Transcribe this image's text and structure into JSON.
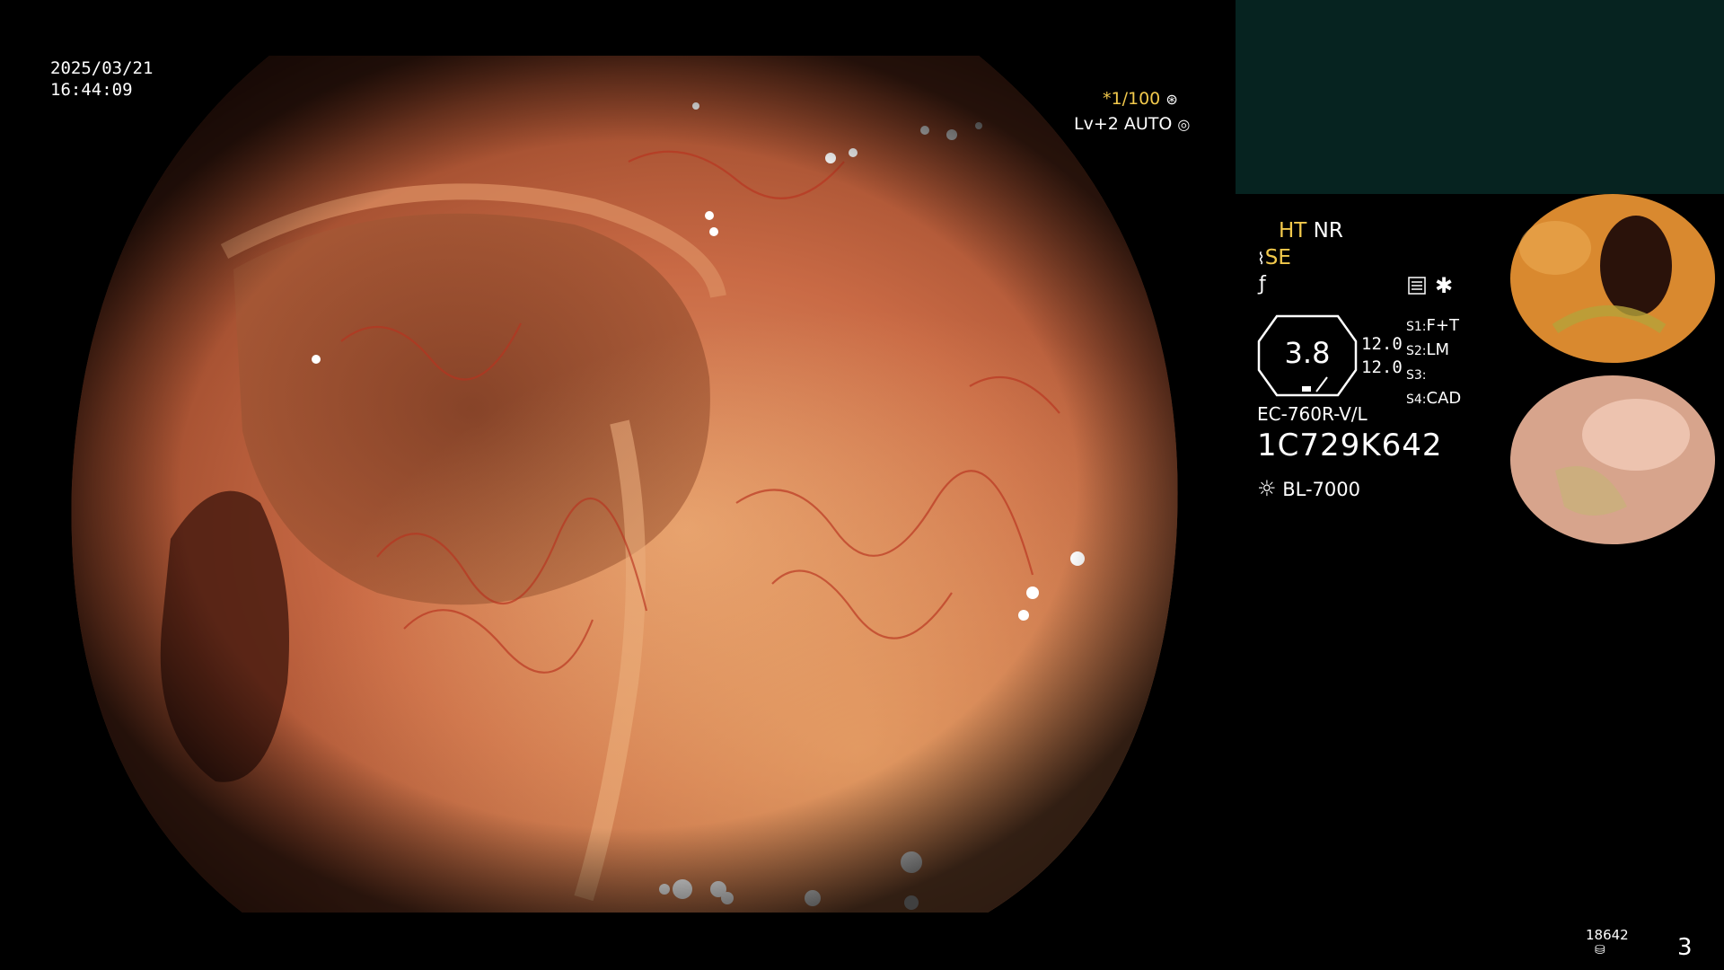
{
  "datetime": {
    "date": "2025/03/21",
    "time": "16:44:09"
  },
  "top_right": {
    "shutter": "*1/100",
    "level": "Lv+2",
    "mode": "AUTO"
  },
  "settings": {
    "ht": "HT",
    "nr": "NR",
    "se": "SE",
    "scale_value": "3.8",
    "values": [
      "12.0",
      "12.0"
    ]
  },
  "switches": [
    {
      "key": "S1:",
      "value": "F+T"
    },
    {
      "key": "S2:",
      "value": "LM"
    },
    {
      "key": "S3:",
      "value": ""
    },
    {
      "key": "S4:",
      "value": "CAD"
    }
  ],
  "scope": {
    "model": "EC-760R-V/L",
    "serial": "1C729K642",
    "light_source": "BL-7000"
  },
  "footer": {
    "count": "18642",
    "page": "3"
  },
  "colors": {
    "accent_yellow": "#f2c94c",
    "panel_teal": "#062320"
  },
  "icons": [
    "shutter-icon",
    "auto-iris-icon",
    "scope-icon",
    "freeze-icon",
    "menu-icon",
    "asterisk-icon",
    "light-icon",
    "storage-icon"
  ]
}
